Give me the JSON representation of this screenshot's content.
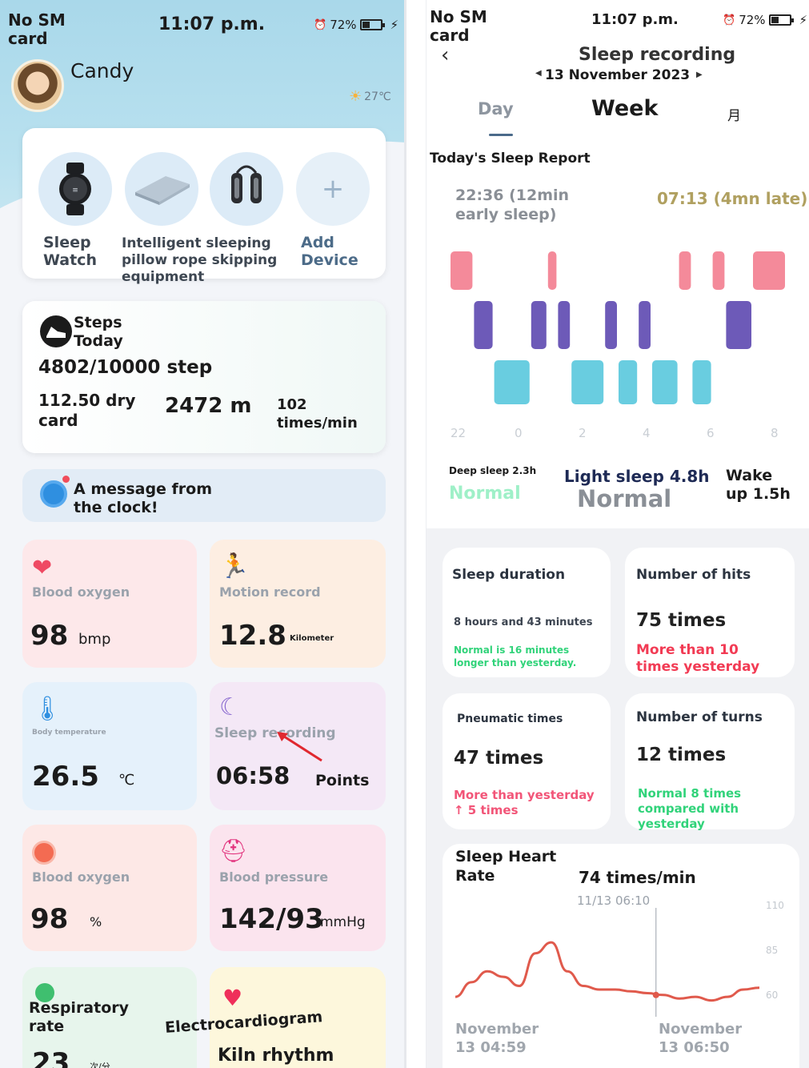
{
  "left": {
    "status": {
      "carrier": "No SM card",
      "time": "11:07 p.m.",
      "battery": "72%"
    },
    "user": {
      "name": "Candy",
      "weather": "27℃"
    },
    "devices": [
      {
        "label": "Sleep Watch",
        "icon": "smartwatch-icon"
      },
      {
        "label": "Intelligent sleeping pillow rope skipping equipment",
        "icon": "pillow-icon"
      },
      {
        "label": "",
        "icon": "skipping-rope-icon"
      },
      {
        "label": "Add Device",
        "icon": "plus-icon"
      }
    ],
    "steps": {
      "title": "Steps Today",
      "count": "4802/10000 step",
      "calories": "112.50 dry card",
      "distance": "2472 m",
      "rate": "102 times/min"
    },
    "message": "A message from the clock!",
    "tiles": {
      "blood_oxygen": {
        "title": "Blood oxygen",
        "value": "98",
        "unit": "bmp"
      },
      "motion": {
        "title": "Motion record",
        "value": "12.8",
        "unit": "Kilometer"
      },
      "body_temp": {
        "title": "Body temperature",
        "value": "26.5",
        "unit": "℃"
      },
      "sleep": {
        "title": "Sleep recording",
        "value": "06:58",
        "unit": "Points"
      },
      "blood_oxygen2": {
        "title": "Blood oxygen",
        "value": "98",
        "unit": "%"
      },
      "blood_pressure": {
        "title": "Blood pressure",
        "value": "142/93",
        "unit": "mmHg"
      },
      "respiratory": {
        "title": "Respiratory rate",
        "value": "23",
        "unit": "次/分"
      },
      "ecg": {
        "title": "Electrocardiogram",
        "value": "Kiln rhythm"
      }
    },
    "colors": {
      "hero": "#a9d8ea",
      "red_tile": "#fde8ea",
      "orange_tile": "#fdeee2",
      "blue_tile": "#e5f1fb",
      "purple_tile": "#f4e8f6",
      "green_tile": "#e7f5ec",
      "yellow_tile": "#fdf7dc"
    }
  },
  "right": {
    "status": {
      "carrier": "No SM card",
      "time": "11:07 p.m.",
      "battery": "72%"
    },
    "header": {
      "title": "Sleep recording",
      "date": "13 November 2023"
    },
    "tabs": [
      "Day",
      "Week",
      "月"
    ],
    "active_tab": "Day",
    "report_title": "Today's Sleep Report",
    "sleep_start": "22:36 (12min early sleep)",
    "wake_time": "07:13 (4mn late)",
    "chart_data": {
      "type": "bar",
      "title": "",
      "x_ticks": [
        "22",
        "0",
        "2",
        "4",
        "6",
        "8"
      ],
      "levels": [
        "Wake",
        "Light sleep",
        "Deep sleep"
      ],
      "segments": [
        {
          "stage": "Wake",
          "start": 0.0,
          "end": 0.07
        },
        {
          "stage": "Light sleep",
          "start": 0.07,
          "end": 0.13
        },
        {
          "stage": "Deep sleep",
          "start": 0.13,
          "end": 0.24
        },
        {
          "stage": "Light sleep",
          "start": 0.24,
          "end": 0.29
        },
        {
          "stage": "Wake",
          "start": 0.29,
          "end": 0.32
        },
        {
          "stage": "Light sleep",
          "start": 0.32,
          "end": 0.36
        },
        {
          "stage": "Deep sleep",
          "start": 0.36,
          "end": 0.46
        },
        {
          "stage": "Light sleep",
          "start": 0.46,
          "end": 0.5
        },
        {
          "stage": "Deep sleep",
          "start": 0.5,
          "end": 0.56
        },
        {
          "stage": "Light sleep",
          "start": 0.56,
          "end": 0.6
        },
        {
          "stage": "Deep sleep",
          "start": 0.6,
          "end": 0.68
        },
        {
          "stage": "Wake",
          "start": 0.68,
          "end": 0.72
        },
        {
          "stage": "Deep sleep",
          "start": 0.72,
          "end": 0.78
        },
        {
          "stage": "Wake",
          "start": 0.78,
          "end": 0.82
        },
        {
          "stage": "Light sleep",
          "start": 0.82,
          "end": 0.9
        },
        {
          "stage": "Wake",
          "start": 0.9,
          "end": 1.0
        }
      ],
      "colors": {
        "Wake": "#f48a9a",
        "Light sleep": "#6d5ab8",
        "Deep sleep": "#69cde0"
      }
    },
    "summary": {
      "deep": {
        "label": "Deep sleep 2.3h",
        "status": "Normal"
      },
      "light": {
        "label": "Light sleep 4.8h",
        "status": "Normal"
      },
      "wake": {
        "label": "Wake up 1.5h"
      }
    },
    "stats": {
      "duration": {
        "title": "Sleep duration",
        "value": "8 hours and 43 minutes",
        "note": "Normal is 16 minutes longer than yesterday."
      },
      "hits": {
        "title": "Number of hits",
        "value": "75 times",
        "note": "More than 10 times yesterday"
      },
      "pneumatic": {
        "title": "Pneumatic times",
        "value": "47 times",
        "note": "More than yesterday ↑ 5 times"
      },
      "turns": {
        "title": "Number of turns",
        "value": "12 times",
        "note": "Normal 8 times compared with yesterday"
      }
    },
    "heart": {
      "title": "Sleep Heart Rate",
      "value": "74 times/min",
      "stamp": "11/13  06:10",
      "y_ticks": [
        "110",
        "85",
        "60"
      ],
      "x_start": "November 13 04:59",
      "x_end": "November 13 06:50",
      "chart_data": {
        "type": "line",
        "ylim": [
          55,
          115
        ],
        "values": [
          66,
          74,
          80,
          77,
          72,
          90,
          96,
          80,
          72,
          70,
          70,
          69,
          68,
          67,
          65,
          66,
          64,
          66,
          70,
          71
        ]
      }
    }
  }
}
